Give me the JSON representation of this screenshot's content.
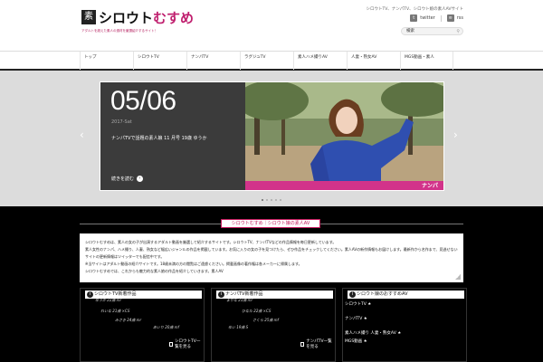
{
  "header": {
    "logo_mark": "素",
    "logo_text_main": "シロウト",
    "logo_text_accent": "むすめ",
    "tagline": "アダルトを超えた素人の逸材を厳選紹介するサイト！",
    "description": "シロウトTV、ナンパTV、シロウト娘の素人AVサイト",
    "twitter_label": "twitter",
    "rss_label": "rss",
    "search_placeholder": "検索"
  },
  "nav": {
    "items": [
      "トップ",
      "シロウトTV",
      "ナンパTV",
      "ラグジュTV",
      "素人ハメ撮りAV",
      "人妻・熟女AV",
      "MGS動画・素人"
    ]
  },
  "slider": {
    "date": "05/06",
    "sub": "2017-Sat",
    "title": "ナンパTVで話題の素人娘 11 月号 19歳 ゆうか",
    "more_label": "続きを読む",
    "photo_badge": "ナンパ",
    "arrow_left": "‹",
    "arrow_right": "›",
    "dots_count": 5,
    "active_dot": 0
  },
  "section": {
    "title": "シロウトむすめ｜シロウト娘の素人AV"
  },
  "intro": {
    "lines": [
      "シロウトむすめは、素人の女の子が出演するアダルト動画を厳選して紹介するサイトです。シロウトTV、ナンパTVなどの作品情報を毎日更新しています。",
      "素人女性のナンパ、ハメ撮り、人妻、熟女など幅広いジャンルの作品を掲載しています。お気に入りの女の子を見つけたら、ぜひ作品をチェックしてください。素人AVの新作情報もお届けします。最新作から名作まで、見逃せない作品を毎日ピックアップしています。",
      "サイトの更新情報はツイッターでも配信中です。",
      "※当サイトはアダルト動画の紹介サイトです。18歳未満の方の閲覧はご遠慮ください。掲載画像の著作権は各メーカーに帰属します。",
      "シロウトむすめでは、これからも魅力的な素人娘の作品を紹介していきます。素人AV"
    ]
  },
  "columns": [
    {
      "title": "シロウトTV新着作品",
      "items": [
        "ゆうか 22歳 mr",
        "れいな 21歳 ×CS",
        "みさき 24歳 mr",
        "あいり 20歳 mf"
      ],
      "link": "シロウトTV一覧を見る"
    },
    {
      "title": "ナンパTV新着作品",
      "items": [
        "まりな 23歳 mr",
        "ひなた 22歳 ×CS",
        "さくら 25歳 mf",
        "ゆい 19歳 S"
      ],
      "link": "ナンパTV一覧を見る"
    },
    {
      "title": "シロウト娘のおすすめAV",
      "items": [
        "シロウトTV ★",
        "ナンパTV ★",
        "素人ハメ撮り 人妻・熟女AV ★",
        "MGS動画 ★"
      ],
      "link": ""
    }
  ],
  "colors": {
    "accent": "#c2185b",
    "dark": "#000000",
    "slide_bg": "#3b3b3b",
    "badge": "#d2338a"
  }
}
